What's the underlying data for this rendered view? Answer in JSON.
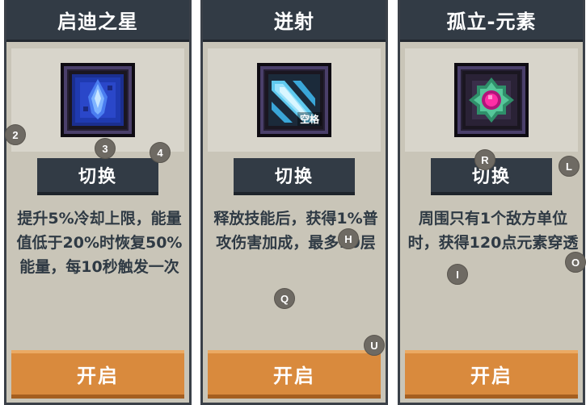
{
  "cards": [
    {
      "title": "启迪之星",
      "icon": "blue-crystal-icon",
      "icon_tag": "",
      "switch_label": "切换",
      "description": "提升5%冷却上限，能量值低于20%时恢复50%能量，每10秒触发一次",
      "open_label": "开启"
    },
    {
      "title": "迸射",
      "icon": "ice-shard-icon",
      "icon_tag": "空格",
      "switch_label": "切换",
      "description": "释放技能后，获得1%普攻伤害加成，最多10层",
      "open_label": "开启"
    },
    {
      "title": "孤立-元素",
      "icon": "pink-orb-icon",
      "icon_tag": "",
      "switch_label": "切换",
      "description": "周围只有1个敌方单位时，获得120点元素穿透",
      "open_label": "开启"
    }
  ],
  "markers": [
    "2",
    "3",
    "4",
    "H",
    "Q",
    "U",
    "R",
    "L",
    "I",
    "O"
  ],
  "colors": {
    "card_bg": "#c9c5b8",
    "header": "#323b45",
    "text": "#2f3a44",
    "accent": "#d98a3d"
  }
}
